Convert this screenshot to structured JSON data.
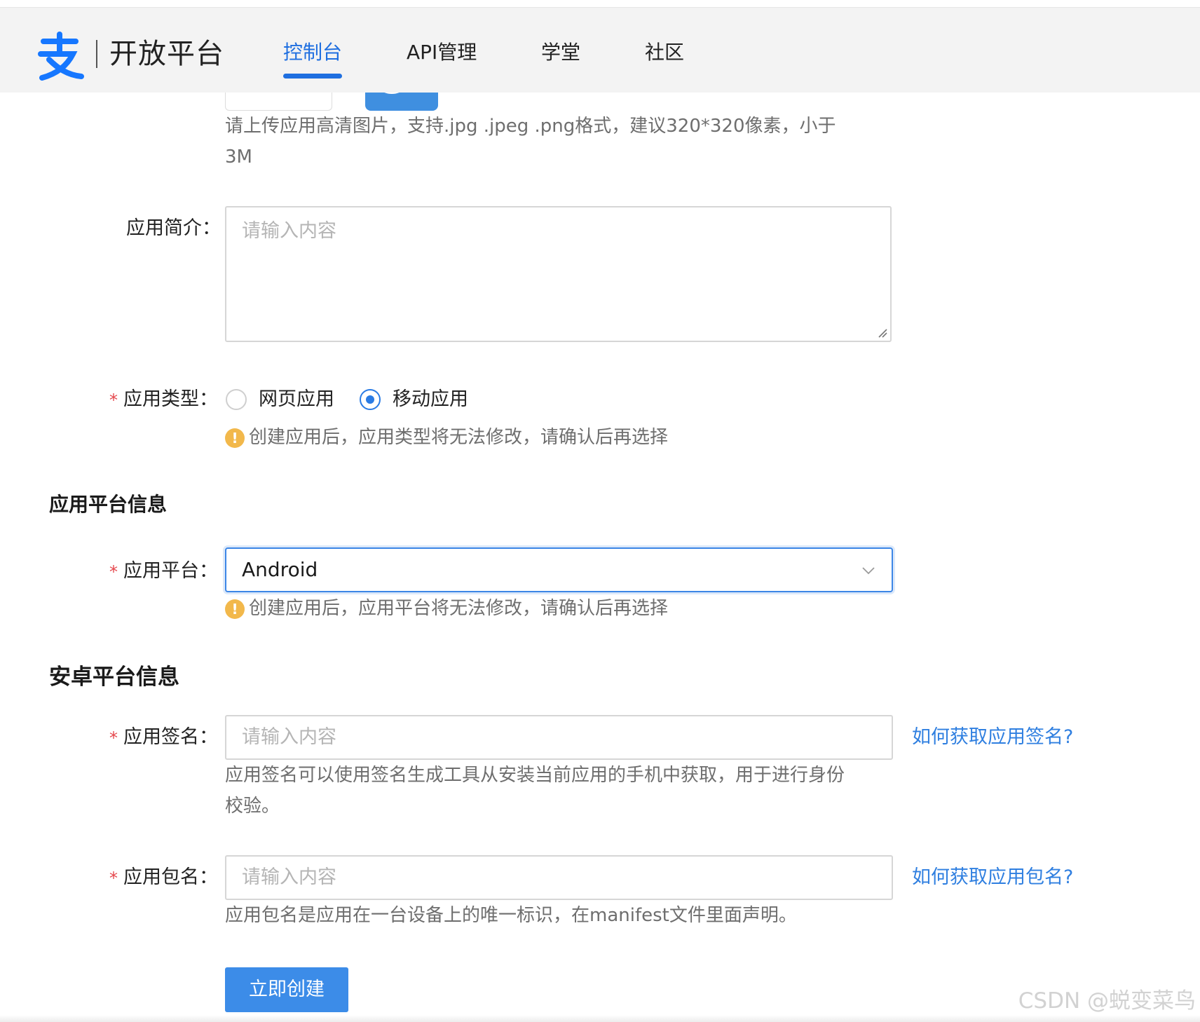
{
  "header": {
    "logo_glyph": "支",
    "brand": "开放平台",
    "nav": [
      {
        "label": "控制台",
        "active": true
      },
      {
        "label": "API管理",
        "active": false
      },
      {
        "label": "学堂",
        "active": false
      },
      {
        "label": "社区",
        "active": false
      }
    ],
    "accent_color": "#1f6fe0"
  },
  "form": {
    "upload_hint": "请上传应用高清图片，支持.jpg .jpeg .png格式，建议320*320像素，小于",
    "upload_hint_2": "3M",
    "intro": {
      "label": "应用简介：",
      "placeholder": "请输入内容"
    },
    "app_type": {
      "required_mark": "*",
      "label": "应用类型：",
      "options": [
        {
          "label": "网页应用",
          "checked": false
        },
        {
          "label": "移动应用",
          "checked": true
        }
      ],
      "warning": "创建应用后，应用类型将无法修改，请确认后再选择"
    },
    "platform_section_title": "应用平台信息",
    "platform": {
      "required_mark": "*",
      "label": "应用平台：",
      "value": "Android",
      "warning": "创建应用后，应用平台将无法修改，请确认后再选择"
    },
    "android_section_title": "安卓平台信息",
    "signature": {
      "required_mark": "*",
      "label": "应用签名：",
      "placeholder": "请输入内容",
      "help_link": "如何获取应用签名?",
      "hint_line1": "应用签名可以使用签名生成工具从安装当前应用的手机中获取，用于进行身份",
      "hint_line2": "校验。"
    },
    "package": {
      "required_mark": "*",
      "label": "应用包名：",
      "placeholder": "请输入内容",
      "help_link": "如何获取应用包名?",
      "hint": "应用包名是应用在一台设备上的唯一标识，在manifest文件里面声明。"
    },
    "submit_label": "立即创建",
    "warning_icon_glyph": "!"
  },
  "watermark": "CSDN @蜕变菜鸟"
}
